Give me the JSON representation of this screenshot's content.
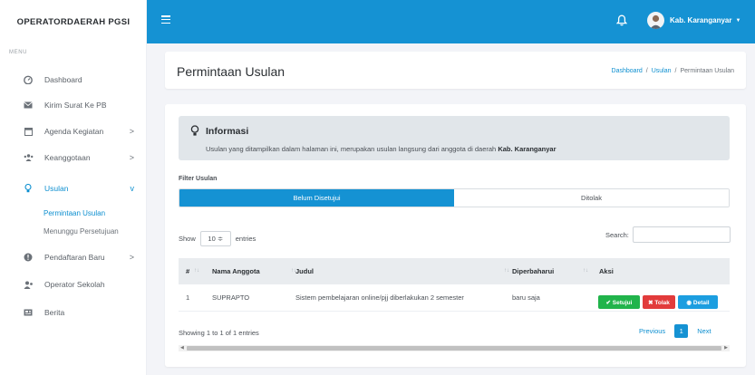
{
  "app": {
    "brand": "OPERATORDAERAH PGSI"
  },
  "sidebar": {
    "menu_label": "MENU",
    "items": [
      {
        "label": "Dashboard",
        "icon": "dashboard-icon"
      },
      {
        "label": "Kirim Surat Ke PB",
        "icon": "envelope-icon"
      },
      {
        "label": "Agenda Kegiatan",
        "icon": "calendar-icon",
        "chevron": ">"
      },
      {
        "label": "Keanggotaan",
        "icon": "users-icon",
        "chevron": ">"
      },
      {
        "label": "Usulan",
        "icon": "lightbulb-icon",
        "chevron": "v"
      },
      {
        "label": "Pendaftaran Baru",
        "icon": "info-circle-icon",
        "chevron": ">"
      },
      {
        "label": "Operator Sekolah",
        "icon": "user-group-icon"
      },
      {
        "label": "Berita",
        "icon": "news-icon"
      }
    ],
    "subitems": [
      {
        "label": "Permintaan Usulan"
      },
      {
        "label": "Menunggu Persetujuan"
      }
    ]
  },
  "topbar": {
    "user_name": "Kab. Karanganyar",
    "caret": "▼"
  },
  "header": {
    "title": "Permintaan Usulan",
    "breadcrumb": [
      "Dashboard",
      "/",
      "Usulan",
      "/",
      "Permintaan Usulan"
    ]
  },
  "info": {
    "title": "Informasi",
    "text": "Usulan yang ditampilkan dalam halaman ini, merupakan usulan langsung dari anggota di daerah",
    "region": "Kab. Karanganyar"
  },
  "filter": {
    "label": "Filter Usulan",
    "tabs": [
      "Belum Disetujui",
      "Ditolak"
    ]
  },
  "table": {
    "show_label": "Show",
    "entries_value": "10 ≑",
    "entries_label": "entries",
    "search_label": "Search:",
    "columns": [
      "#",
      "Nama Anggota",
      "Judul",
      "Diperbaharui",
      "Aksi"
    ],
    "rows": [
      {
        "no": "1",
        "nama": "SUPRAPTO",
        "judul": "Sistem pembelajaran online/pjj diberlakukan 2 semester",
        "diperbaharui": "baru saja"
      }
    ],
    "actions": {
      "approve": "✔ Setujui",
      "reject": "✖ Tolak",
      "detail": "◉ Detail"
    },
    "footer_info": "Showing 1 to 1 of 1 entries",
    "pager": {
      "prev": "Previous",
      "current": "1",
      "next": "Next"
    }
  },
  "colors": {
    "primary": "#1592d3",
    "success": "#21b44b",
    "danger": "#e23b3b",
    "info": "#1c9ee0"
  }
}
